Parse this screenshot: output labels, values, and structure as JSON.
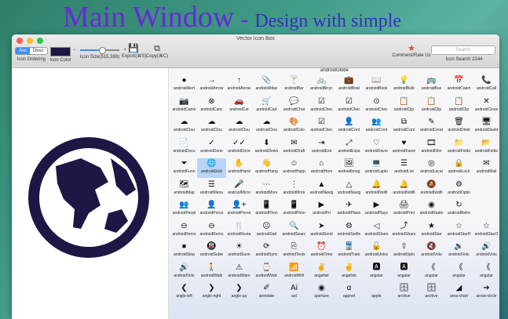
{
  "promo": {
    "title": "Main Window",
    "dash": "-",
    "subtitle": "Design with simple"
  },
  "window": {
    "title": "Vector Icon Box"
  },
  "toolbar": {
    "ordering": {
      "asc": "Asc",
      "desc": "Desc",
      "label": "Icon Ordering"
    },
    "color": {
      "label": "Icon Color",
      "value": "#1f1646"
    },
    "size": {
      "label": "Icon Size(515,388)",
      "fraction": 0.55
    },
    "export": {
      "label": "Export(⌘S)"
    },
    "copy": {
      "label": "Copy(⌘C)"
    },
    "comment": {
      "label": "Comment/Rate Us"
    },
    "search": {
      "placeholder": "Search",
      "label": "Icon Search 2344"
    }
  },
  "selected_icon": {
    "name": "androidGlobe",
    "color": "#1f1646"
  },
  "grid": {
    "rows": [
      [
        "androidAlert",
        "androidArrow",
        "androidArrow",
        "androidAttac",
        "androidBar",
        "androidBicyc",
        "androidBoat",
        "androidBook",
        "androidBulb",
        "androidBus",
        "androidCalen",
        "androidCall"
      ],
      [
        "androidCame",
        "androidCanc",
        "androidCar",
        "androidCart",
        "androidChat",
        "androidChec",
        "androidChec",
        "androidChec",
        "androidClip",
        "androidClip",
        "androidClip",
        "androidClose"
      ],
      [
        "androidClou",
        "androidClou",
        "androidClou",
        "androidClou",
        "androidColo",
        "androidChec",
        "androidCont",
        "androidCont",
        "androidCont",
        "androidCreat",
        "androidDelet",
        "androidDeskt"
      ],
      [
        "androidDocu",
        "androidDone",
        "androidDone",
        "androidDown",
        "androidDraft",
        "androidExit",
        "androidExpa",
        "androidFavor",
        "androidFavor",
        "androidFilm",
        "androidFolde",
        "androidFolde"
      ],
      [
        "androidFunn",
        "androidGlob",
        "androidHand",
        "androidHang",
        "androidHapp",
        "androidHom",
        "androidImag",
        "androidLapto",
        "androidList",
        "androidLocat",
        "androidLock",
        "androidMail"
      ],
      [
        "androidMap",
        "androidMenu",
        "androidMicro",
        "androidMore",
        "androidMore",
        "androidNavig",
        "androidNavig",
        "androidNotifi",
        "androidNotifi",
        "androidNotifi",
        "androidOptio"
      ],
      [
        "androidPeopl",
        "androidPerso",
        "androidPerso",
        "androidPhon",
        "androidPhon",
        "androidPri",
        "androidPlane",
        "androidPlays",
        "androidPrint",
        "androidRadio",
        "androidRefre"
      ],
      [
        "androidRemo",
        "androidRemo",
        "androidResta",
        "androidSad",
        "androidSearc",
        "androidSend",
        "androidSettin",
        "androidShare",
        "androidShare",
        "androidStar",
        "androidStarH",
        "androidStarO"
      ],
      [
        "androidStop",
        "androidSubw",
        "androidSunn",
        "androidSync",
        "androidTexts",
        "androidTime",
        "androidTrain",
        "androidUnloc",
        "androidUplo",
        "androidVolu",
        "androidVolu",
        "androidVolu"
      ],
      [
        "androidVolu",
        "androidWalk",
        "androidWarn",
        "androidWatc",
        "androidWifi",
        "angellist",
        "angellist",
        "angular",
        "angular",
        "angular",
        "angular",
        "angular"
      ],
      [
        "angle-left",
        "angle-right",
        "angle-up",
        "annotate",
        "aol",
        "aperture",
        "appnet",
        "apple",
        "archive",
        "archive",
        "area-chart",
        "arrow-circle"
      ]
    ],
    "icons": [
      [
        "●",
        "→",
        "↑",
        "📎",
        "🍸",
        "🚲",
        "💼",
        "📖",
        "💡",
        "🚌",
        "📅",
        "📞"
      ],
      [
        "📷",
        "⊗",
        "🚗",
        "🛒",
        "💬",
        "☑",
        "☑",
        "⊙",
        "📋",
        "📋",
        "📋",
        "✕"
      ],
      [
        "☁",
        "☁",
        "☁",
        "☁",
        "🎨",
        "☑",
        "👤",
        "👥",
        "⧉",
        "✎",
        "🗑",
        "🖥"
      ],
      [
        "📄",
        "✓",
        "✓✓",
        "⬇",
        "✉",
        "⇥",
        "⤢",
        "♡",
        "♥",
        "🎞",
        "📁",
        "📂"
      ],
      [
        "⏷",
        "🌐",
        "✋",
        "👋",
        "☺",
        "⌂",
        "🖼",
        "💻",
        "☰",
        "◎",
        "🔒",
        "✉"
      ],
      [
        "🗺",
        "☰",
        "🎤",
        "⋯",
        "⋮",
        "▲",
        "△",
        "🔔",
        "🔔",
        "🔕",
        "⚙"
      ],
      [
        "👥",
        "👤",
        "👤+",
        "📱",
        "📱",
        "▶",
        "✈",
        "▶",
        "🖨",
        "◉",
        "↻"
      ],
      [
        "⊖",
        "⊖",
        "🍴",
        "☹",
        "🔍",
        "➤",
        "⚙",
        "◁",
        "⤴",
        "★",
        "☆",
        "☆"
      ],
      [
        "⏹",
        "🚇",
        "☀",
        "⟳",
        "⎘",
        "⏰",
        "🚆",
        "🔓",
        "⇧",
        "🔇",
        "🔉",
        "🔊"
      ],
      [
        "🔊",
        "🚶",
        "⚠",
        "⌚",
        "📶",
        "✌",
        "✌",
        "🅰",
        "🅰",
        "《",
        "《",
        "《"
      ],
      [
        "❮",
        "❯",
        "❯",
        "✐",
        "Ai",
        "◉",
        "α",
        "",
        "🗄",
        "🗄",
        "◢",
        "➔"
      ]
    ]
  }
}
